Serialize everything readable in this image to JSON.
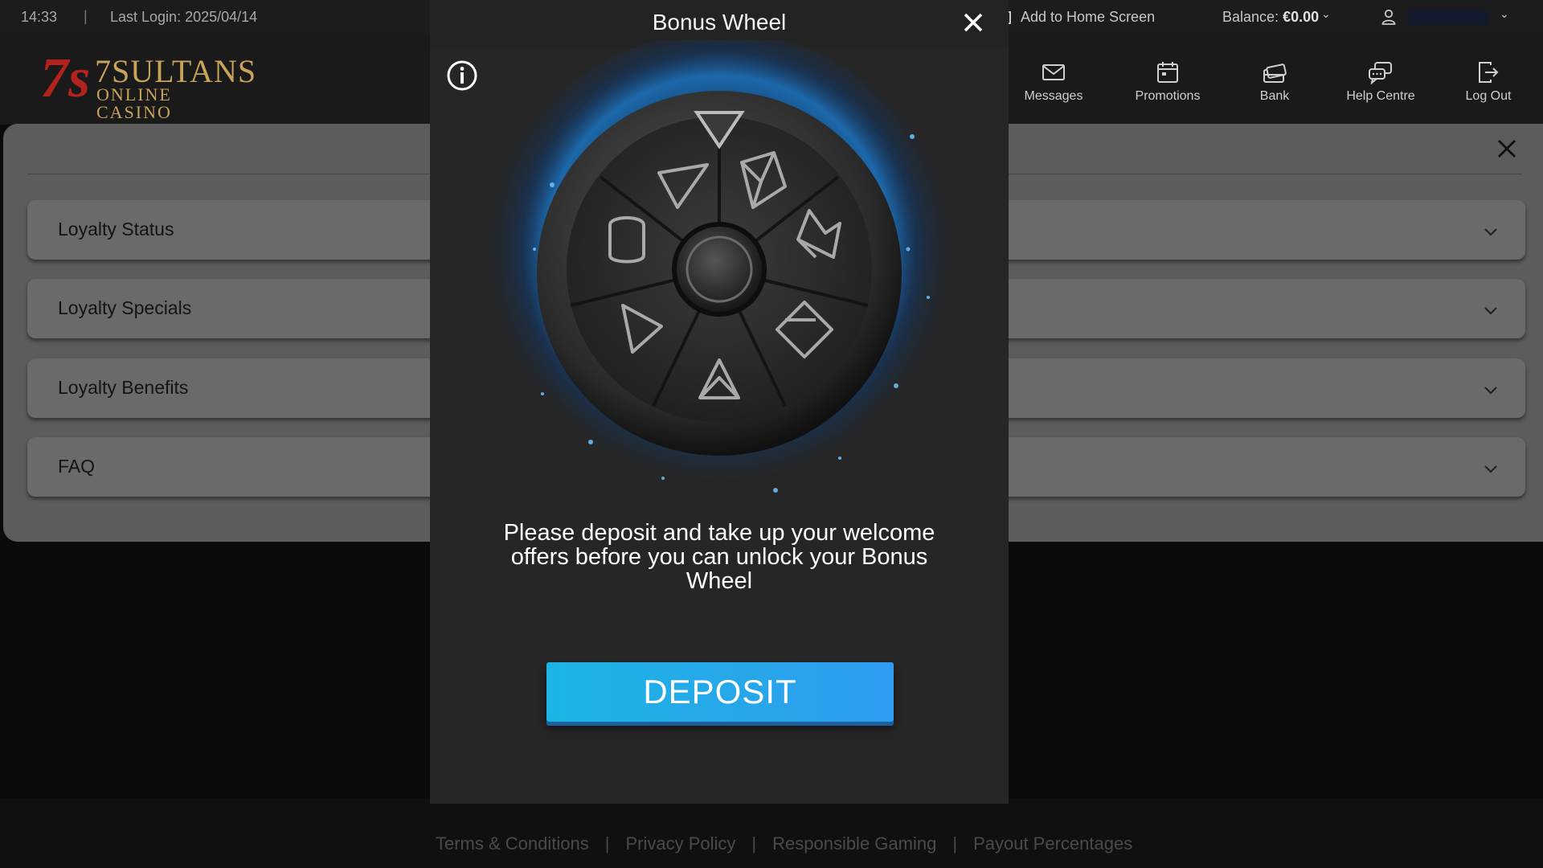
{
  "status_bar": {
    "time": "14:33",
    "separator": "|",
    "last_login": "Last Login: 2025/04/14",
    "add_to_home": "Add to Home Screen",
    "balance_label": "Balance:",
    "balance_value": "€0.00"
  },
  "header": {
    "logo_mark": "7s",
    "logo_brand": "7SULTANS",
    "logo_sub": "ONLINE CASINO",
    "nav": [
      {
        "label": "Messages",
        "icon": "envelope-icon"
      },
      {
        "label": "Promotions",
        "icon": "calendar-icon"
      },
      {
        "label": "Bank",
        "icon": "bank-cards-icon"
      },
      {
        "label": "Help Centre",
        "icon": "chat-bubbles-icon"
      },
      {
        "label": "Log Out",
        "icon": "logout-icon"
      }
    ]
  },
  "loyalty": {
    "sections": [
      {
        "label": "Loyalty Status"
      },
      {
        "label": "Loyalty Specials"
      },
      {
        "label": "Loyalty Benefits"
      },
      {
        "label": "FAQ"
      }
    ]
  },
  "modal": {
    "title": "Bonus Wheel",
    "message": "Please deposit and take up your welcome offers before you can unlock your Bonus Wheel",
    "button": "DEPOSIT",
    "wheel_icons": [
      "arrow-icon",
      "diamond-icon",
      "jester-hat-icon",
      "tickets-icon",
      "diamond-icon",
      "arrow-icon",
      "coins-star-icon"
    ]
  },
  "footer": {
    "links": [
      "Terms & Conditions",
      "Privacy Policy",
      "Responsible Gaming",
      "Payout Percentages"
    ],
    "separator": "|"
  },
  "colors": {
    "accent": "#2aa7ea",
    "brand_red": "#b3231d",
    "brand_gold": "#c8a35a"
  }
}
